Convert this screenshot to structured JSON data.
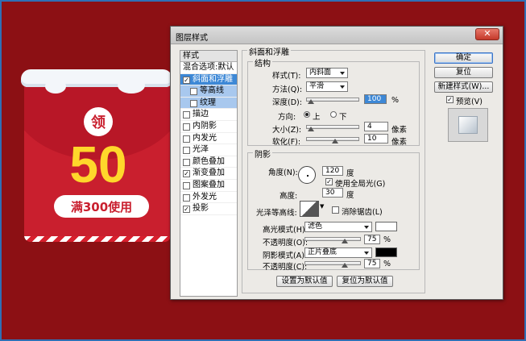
{
  "coupon": {
    "badge": "领",
    "amount": "50",
    "condition": "满300使用"
  },
  "dialog": {
    "title": "图层样式",
    "close_label": "✕",
    "styles_header": "样式",
    "styles": [
      {
        "label": "混合选项:默认",
        "checkbox": false,
        "checked": false,
        "indent": false,
        "selected": false
      },
      {
        "label": "斜面和浮雕",
        "checkbox": true,
        "checked": true,
        "indent": false,
        "selected": true
      },
      {
        "label": "等高线",
        "checkbox": true,
        "checked": false,
        "indent": true,
        "selected": false
      },
      {
        "label": "纹理",
        "checkbox": true,
        "checked": false,
        "indent": true,
        "selected": false
      },
      {
        "label": "描边",
        "checkbox": true,
        "checked": false,
        "indent": false,
        "selected": false
      },
      {
        "label": "内阴影",
        "checkbox": true,
        "checked": false,
        "indent": false,
        "selected": false
      },
      {
        "label": "内发光",
        "checkbox": true,
        "checked": false,
        "indent": false,
        "selected": false
      },
      {
        "label": "光泽",
        "checkbox": true,
        "checked": false,
        "indent": false,
        "selected": false
      },
      {
        "label": "颜色叠加",
        "checkbox": true,
        "checked": false,
        "indent": false,
        "selected": false
      },
      {
        "label": "渐变叠加",
        "checkbox": true,
        "checked": true,
        "indent": false,
        "selected": false
      },
      {
        "label": "图案叠加",
        "checkbox": true,
        "checked": false,
        "indent": false,
        "selected": false
      },
      {
        "label": "外发光",
        "checkbox": true,
        "checked": false,
        "indent": false,
        "selected": false
      },
      {
        "label": "投影",
        "checkbox": true,
        "checked": true,
        "indent": false,
        "selected": false
      }
    ],
    "bevel_group_title": "斜面和浮雕",
    "structure": {
      "title": "结构",
      "style_label": "样式(T):",
      "style_value": "内斜面",
      "technique_label": "方法(Q):",
      "technique_value": "平滑",
      "depth_label": "深度(D):",
      "depth_value": "100",
      "depth_unit": "%",
      "depth_fraction": 0.02,
      "direction_label": "方向:",
      "direction_up": "上",
      "direction_down": "下",
      "size_label": "大小(Z):",
      "size_value": "4",
      "size_unit": "像素",
      "size_fraction": 0.02,
      "soften_label": "软化(F):",
      "soften_value": "10",
      "soften_unit": "像素",
      "soften_fraction": 0.55
    },
    "shading": {
      "title": "阴影",
      "angle_label": "角度(N):",
      "angle_value": "120",
      "angle_unit": "度",
      "global_light_label": "使用全局光(G)",
      "altitude_label": "高度:",
      "altitude_value": "30",
      "altitude_unit": "度",
      "gloss_contour_label": "光泽等高线:",
      "anti_aliased_label": "消除锯齿(L)",
      "highlight_mode_label": "高光模式(H):",
      "highlight_mode_value": "滤色",
      "highlight_color": "#ffffff",
      "highlight_opacity_label": "不透明度(O):",
      "highlight_opacity_value": "75",
      "highlight_opacity_unit": "%",
      "highlight_opacity_fraction": 0.75,
      "shadow_mode_label": "阴影模式(A):",
      "shadow_mode_value": "正片叠底",
      "shadow_color": "#000000",
      "shadow_opacity_label": "不透明度(C):",
      "shadow_opacity_value": "75",
      "shadow_opacity_unit": "%",
      "shadow_opacity_fraction": 0.75
    },
    "make_default_label": "设置为默认值",
    "reset_default_label": "复位为默认值",
    "ok_label": "确定",
    "reset_label": "复位",
    "new_style_label": "新建样式(W)...",
    "preview_label": "预览(V)"
  },
  "colors": {
    "background": "#8c1014",
    "coupon_red": "#c91f2e",
    "coupon_amount": "#ffd72b",
    "selection_blue": "#3d88d6"
  }
}
